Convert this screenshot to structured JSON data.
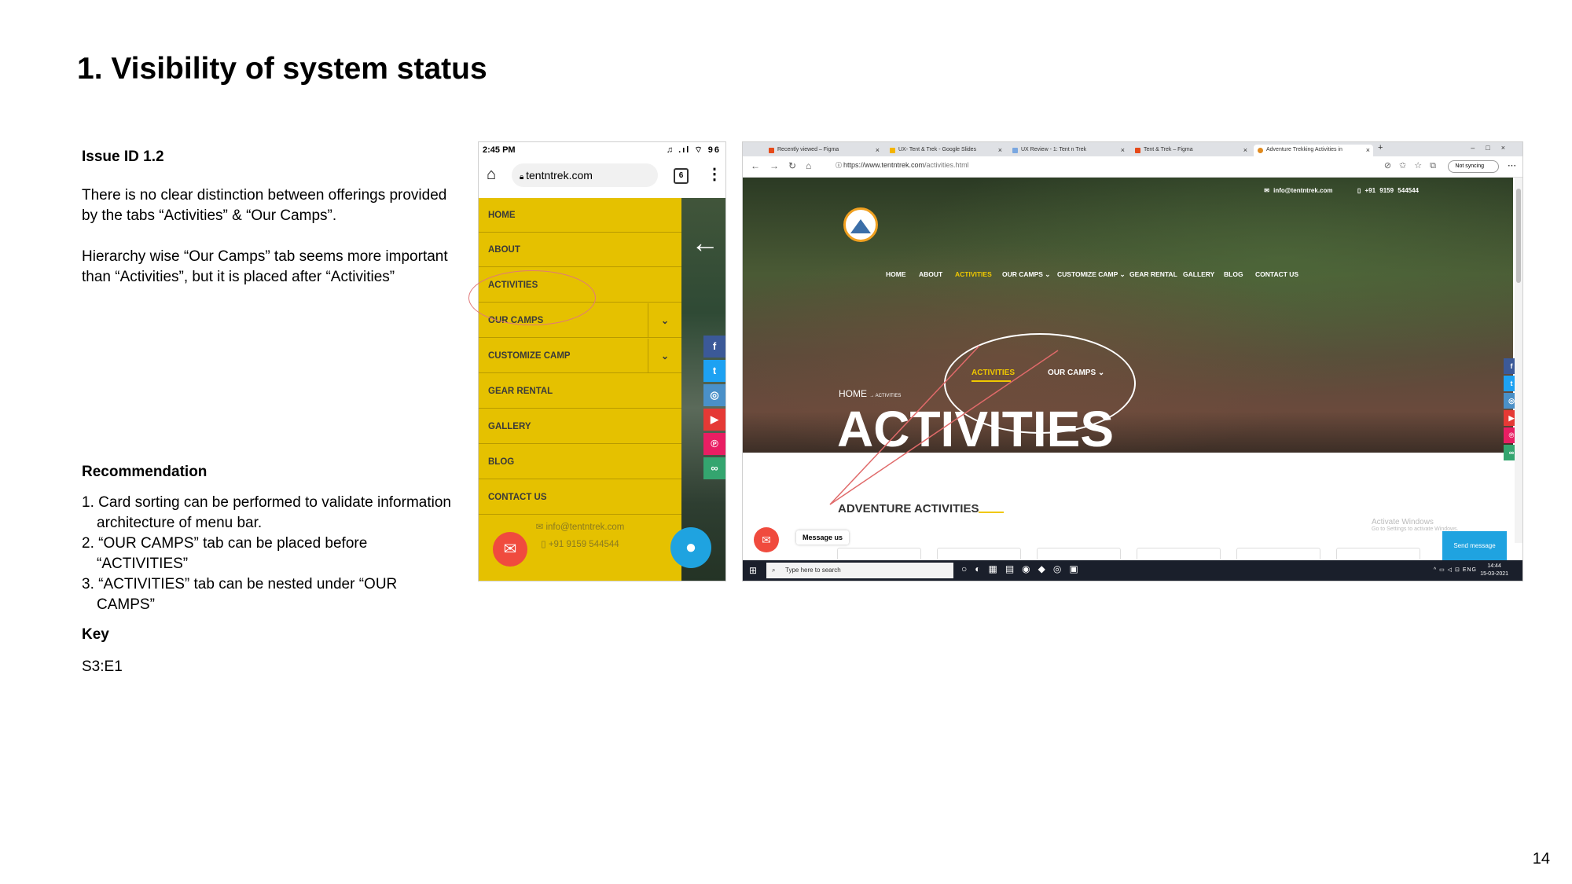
{
  "slide": {
    "title": "1. Visibility of system status",
    "page_number": "14"
  },
  "issue": {
    "id_label": "Issue ID 1.2",
    "paragraph1": "There is no clear distinction between offerings provided by the tabs “Activities” & “Our Camps”.",
    "paragraph2": "Hierarchy wise “Our Camps” tab seems more important than “Activities”, but it is placed after “Activities”"
  },
  "recommendation": {
    "heading": "Recommendation",
    "items": [
      "1. Card sorting can be performed to validate information architecture of menu bar.",
      "2. “OUR CAMPS” tab can be placed before “ACTIVITIES”",
      "3. “ACTIVITIES” tab can be nested under “OUR CAMPS”"
    ]
  },
  "key": {
    "heading": "Key",
    "value": "S3:E1"
  },
  "mobile": {
    "time": "2:45 PM",
    "status_icons": "♫ .ıl ⌔ 96",
    "url": "tentntrek.com",
    "tab_count": "6",
    "menu_items": [
      "HOME",
      "ABOUT",
      "ACTIVITIES",
      "OUR CAMPS",
      "CUSTOMIZE CAMP",
      "GEAR RENTAL",
      "GALLERY",
      "BLOG",
      "CONTACT US"
    ],
    "email": "✉ info@tentntrek.com",
    "phone": "▯ +91 9159 544544",
    "menu_color": "#e5c100",
    "highlight_color": "#e0787a"
  },
  "desktop": {
    "tabs": [
      "Recently viewed – Figma",
      "UX- Tent & Trek - Google Slides",
      "UX Review - 1: Tent n Trek",
      "Tent & Trek – Figma",
      "Adventure Trekking Activities in"
    ],
    "address_host": "https://www.tentntrek.com",
    "address_path": "/activities.html",
    "sync_label": "Not syncing",
    "hero_email": "✉ info@tentntrek.com",
    "hero_phone": "▯ +91 9159 544544",
    "nav": [
      "HOME",
      "ABOUT",
      "ACTIVITIES",
      "OUR CAMPS ⌄",
      "CUSTOMIZE CAMP ⌄",
      "GEAR RENTAL",
      "GALLERY",
      "BLOG",
      "CONTACT US"
    ],
    "zoom_activities": "ACTIVITIES",
    "zoom_our_camps": "OUR CAMPS ⌄",
    "breadcrumb_home": "HOME",
    "breadcrumb_current": "→ ACTIVITIES",
    "hero_heading": "ACTIVITIES",
    "section_heading": "ADVENTURE ACTIVITIES",
    "watermark_title": "Activate Windows",
    "watermark_sub": "Go to Settings to activate Windows.",
    "send_message": "Send message",
    "message_us": "Message us",
    "taskbar_search": "Type here to search",
    "tray": "^ ▭ ◁ ⊡ ENG",
    "clock_time": "14:44",
    "clock_date": "15-03-2021",
    "accent_yellow": "#f0c800"
  }
}
